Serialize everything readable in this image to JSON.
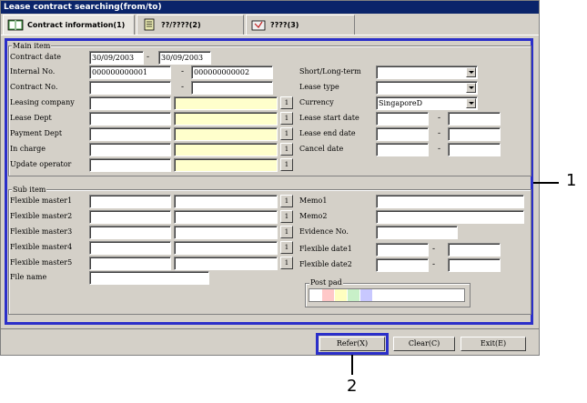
{
  "window": {
    "title": "Lease contract searching(from/to)"
  },
  "tabs": [
    {
      "label": "Contract information(1)",
      "icon": "book-icon"
    },
    {
      "label": "??/????(2)",
      "icon": "document-icon"
    },
    {
      "label": "????(3)",
      "icon": "folder-icon"
    }
  ],
  "main_item": {
    "title": "Main item",
    "contract_date": {
      "label": "Contract date",
      "from": "30/09/2003",
      "to": "30/09/2003"
    },
    "internal_no": {
      "label": "Internal No.",
      "from": "000000000001",
      "to": "000000000002"
    },
    "contract_no": {
      "label": "Contract No."
    },
    "leasing_company": {
      "label": "Leasing company"
    },
    "lease_dept": {
      "label": "Lease Dept"
    },
    "payment_dept": {
      "label": "Payment Dept"
    },
    "in_charge": {
      "label": "In charge"
    },
    "update_operator": {
      "label": "Update operator"
    },
    "short_long_term": {
      "label": "Short/Long-term"
    },
    "lease_type": {
      "label": "Lease type"
    },
    "currency": {
      "label": "Currency",
      "value": "SingaporeD"
    },
    "lease_start_date": {
      "label": "Lease start date"
    },
    "lease_end_date": {
      "label": "Lease end date"
    },
    "cancel_date": {
      "label": "Cancel date"
    }
  },
  "sub_item": {
    "title": "Sub item",
    "flex1": "Flexible master1",
    "flex2": "Flexible master2",
    "flex3": "Flexible master3",
    "flex4": "Flexible master4",
    "flex5": "Flexible master5",
    "file_name": "File name",
    "memo1": "Memo1",
    "memo2": "Memo2",
    "evidence_no": "Evidence No.",
    "flex_date1": "Flexible date1",
    "flex_date2": "Flexible date2",
    "post_pad": "Post pad"
  },
  "common": {
    "lookup_button": "1",
    "range_sep": "-"
  },
  "buttons": {
    "refer": "Refer(X)",
    "clear": "Clear(C)",
    "exit": "Exit(E)"
  },
  "callouts": {
    "one": "1",
    "two": "2"
  },
  "colors": {
    "highlight": "#2b2fc9",
    "yellow_field": "#ffffcc",
    "title_bar": "#0a246a",
    "swatches": [
      "#ffffff",
      "#ffc8c8",
      "#ffffc0",
      "#c8f0c8",
      "#c8c8ff"
    ]
  }
}
